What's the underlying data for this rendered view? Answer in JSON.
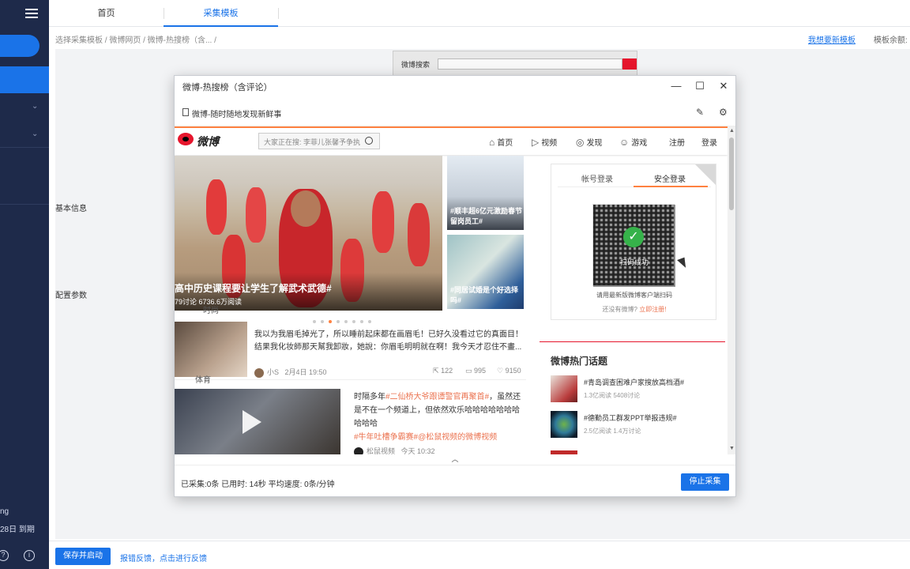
{
  "app": {
    "sidebar": {
      "user_suffix": "ng",
      "expire_text": "28日 到期"
    },
    "tabs": [
      {
        "label": "首页"
      },
      {
        "label": "采集模板"
      }
    ],
    "breadcrumb": "选择采集模板 / 微博网页 / 微博-热搜榜（含... /",
    "new_template_link": "我想要新模板",
    "quota_label": "模板余额:",
    "sections": {
      "basic": "基本信息",
      "config": "配置参数"
    },
    "background_strip_label": "微博搜索",
    "bottom": {
      "save_button": "保存并启动",
      "feedback_link": "报错反馈，点击进行反馈"
    }
  },
  "modal": {
    "title": "微博-热搜榜（含评论）",
    "url_title": "微博-随时随地发现新鲜事",
    "status_text": "已采集:0条  已用时: 14秒  平均速度: 0条/分钟",
    "stop_button": "停止采集",
    "collapse_icon": "chevron-up-icon"
  },
  "weibo": {
    "logo": "微博",
    "search_placeholder": "大家正在搜: 李菲儿张馨予争执",
    "nav": [
      {
        "icon": "home-icon",
        "label": "首页"
      },
      {
        "icon": "video-icon",
        "label": "视频"
      },
      {
        "icon": "compass-icon",
        "label": "发现"
      },
      {
        "icon": "game-icon",
        "label": "游戏"
      },
      {
        "icon": "",
        "label": "注册"
      },
      {
        "icon": "",
        "label": "登录"
      }
    ],
    "hero": {
      "title": "高中历史课程要让学生了解武术武德#",
      "meta": "79讨论     6736.6万阅读"
    },
    "side_cards": [
      {
        "title": "#顺丰超6亿元激励春节留岗员工#"
      },
      {
        "title": "#同居试婚是个好选择吗#"
      }
    ],
    "faded_labels": {
      "a": "时尚",
      "b": "体育"
    },
    "feed1": {
      "text": "我以为我眉毛掉光了，所以睡前起床都在画眉毛！已好久没看过它的真面目！结果我化妆師那天幫我卸妝，她說：你眉毛明明就在啊！我今天才忍住不畫...",
      "author": "小S",
      "time": "2月4日 19:50",
      "reposts": "122",
      "comments": "995",
      "likes": "9150"
    },
    "feed2": {
      "text_pre": "时隔多年",
      "tag1": "#二仙桥大爷跟谭警官再聚首#",
      "text_mid": "，虽然还是不在一个频道上，但依然欢乐哈哈哈哈哈哈哈哈哈哈",
      "tag2": "#牛年吐槽争霸赛#",
      "tag3": "@松鼠视频的微博视频",
      "author": "松鼠视频",
      "time": "今天 10:32"
    },
    "login": {
      "tab_account": "帐号登录",
      "tab_secure": "安全登录",
      "scan_success": "扫码成功",
      "qr_hint": "请用最新版微博客户端扫码",
      "no_account": "还没有微博?",
      "register_now": "立即注册!"
    },
    "hot_topics": {
      "title": "微博热门话题",
      "items": [
        {
          "title": "#青岛调查困难户家搜放高档酒#",
          "stats": "1.3亿阅读 5408讨论"
        },
        {
          "title": "#德勤员工群发PPT举报违规#",
          "stats": "2.5亿阅读 1.4万讨论"
        }
      ]
    }
  }
}
